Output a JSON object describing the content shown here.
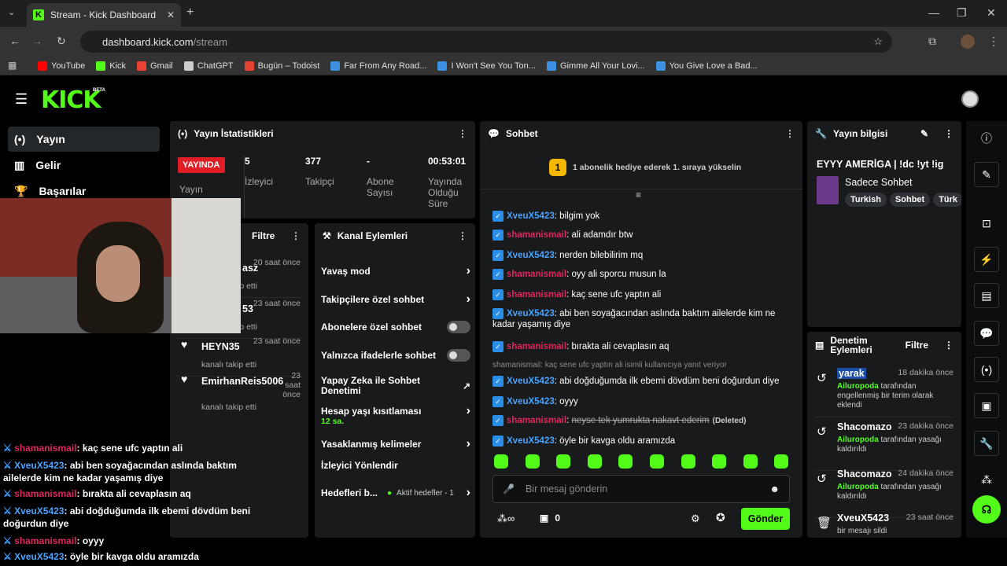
{
  "browser": {
    "tab_title": "Stream - Kick Dashboard",
    "url_host": "dashboard.kick.com",
    "url_path": "/stream",
    "bookmarks": [
      {
        "label": "YouTube",
        "color": "#ff0000"
      },
      {
        "label": "Kick",
        "color": "#53fc18"
      },
      {
        "label": "Gmail",
        "color": "#ea4335"
      },
      {
        "label": "ChatGPT",
        "color": "#cccccc"
      },
      {
        "label": "Bugün – Todoist",
        "color": "#e44332"
      },
      {
        "label": "Far From Any Road...",
        "color": "#3d8fe0"
      },
      {
        "label": "I Won't See You Ton...",
        "color": "#3d8fe0"
      },
      {
        "label": "Gimme All Your Lovi...",
        "color": "#3d8fe0"
      },
      {
        "label": "You Give Love a Bad...",
        "color": "#3d8fe0"
      }
    ]
  },
  "nav": {
    "logo": "KICK",
    "beta": "BETA",
    "items": [
      "Yayın",
      "Gelir",
      "Başarılar"
    ]
  },
  "stats": {
    "title": "Yayın İstatistikleri",
    "live_badge": "YAYINDA",
    "stream_label": "Yayın",
    "viewers": {
      "value": "5",
      "label": "İzleyici"
    },
    "followers": {
      "value": "377",
      "label": "Takipçi"
    },
    "subs": {
      "value": "-",
      "label": "Abone Sayısı"
    },
    "duration": {
      "value": "00:53:01",
      "label": "Yayında Olduğu Süre"
    }
  },
  "activity": {
    "filter": "Filtre",
    "items": [
      {
        "name": "asz",
        "time": "20 saat önce",
        "sub": "ip etti"
      },
      {
        "name": "53",
        "time": "23 saat önce",
        "sub": "ip etti"
      },
      {
        "name": "HEYN35",
        "time": "23 saat önce",
        "sub": "kanalı takip etti"
      },
      {
        "name": "EmirhanReis5006",
        "time": "23 saat önce",
        "sub": "kanalı takip etti"
      }
    ]
  },
  "actions": {
    "title": "Kanal Eylemleri",
    "items": [
      {
        "label": "Yavaş mod",
        "type": "chev"
      },
      {
        "label": "Takipçilere özel sohbet",
        "type": "chev"
      },
      {
        "label": "Abonelere özel sohbet",
        "type": "toggle"
      },
      {
        "label": "Yalnızca ifadelerle sohbet",
        "type": "toggle"
      },
      {
        "label": "Yapay Zeka ile Sohbet Denetimi",
        "type": "ext"
      },
      {
        "label": "Hesap yaşı kısıtlaması",
        "type": "chev",
        "sub": "12 sa."
      },
      {
        "label": "Yasaklanmış kelimeler",
        "type": "chev"
      },
      {
        "label": "İzleyici Yönlendir",
        "type": "none"
      },
      {
        "label": "Hedefleri b...",
        "type": "chev",
        "sub": "Aktif hedefler - 1"
      }
    ]
  },
  "chat": {
    "title": "Sohbet",
    "gift_banner": "1 abonelik hediye ederek 1. sıraya yükselin",
    "reply_note": "shamanismail: kaç sene ufc yaptın ali isimli kullanıcıya yanıt veriyor",
    "messages": [
      {
        "user": "XveuX5423",
        "text": "bilgim yok",
        "c": 1
      },
      {
        "user": "shamanismail",
        "text": "ali adamdır btw",
        "c": 2
      },
      {
        "user": "XveuX5423",
        "text": "nerden bilebilirim mq",
        "c": 1
      },
      {
        "user": "shamanismail",
        "text": "oyy ali sporcu musun la",
        "c": 2
      },
      {
        "user": "shamanismail",
        "text": "kaç sene ufc yaptın ali",
        "c": 2
      },
      {
        "user": "XveuX5423",
        "text": "abi ben soyağacından aslında baktım ailelerde kim ne kadar yaşamış diye",
        "c": 1
      },
      {
        "user": "shamanismail",
        "text": "bırakta ali cevaplasın aq",
        "c": 2
      },
      {
        "user": "XveuX5423",
        "text": "abi doğduğumda ilk ebemi dövdüm beni doğurdun diye",
        "c": 1
      },
      {
        "user": "XveuX5423",
        "text": "oyyy",
        "c": 1
      },
      {
        "user": "shamanismail",
        "text": "neyse tek yumrukta nakavt ederim",
        "c": 2,
        "deleted": "(Deleted)"
      },
      {
        "user": "XveuX5423",
        "text": "öyle bir kavga oldu aramızda",
        "c": 1
      }
    ],
    "input_placeholder": "Bir mesaj gönderin",
    "points": "0",
    "send": "Gönder"
  },
  "info": {
    "title": "Yayın bilgisi",
    "stream_title": "EYYY AMERİGA | !dc !yt !ig",
    "category": "Sadece Sohbet",
    "tags": [
      "Turkish",
      "Sohbet",
      "Türk"
    ]
  },
  "moderation": {
    "title": "Denetim Eylemleri",
    "filter": "Filtre",
    "items": [
      {
        "name": "yarak",
        "time": "18 dakika önce",
        "by": "Ailuropoda",
        "desc": " tarafından engellenmiş bir terim olarak eklendi"
      },
      {
        "name": "Shacomazo",
        "time": "23 dakika önce",
        "by": "Ailuropoda",
        "desc": " tarafından yasağı kaldırıldı"
      },
      {
        "name": "Shacomazo",
        "time": "24 dakika önce",
        "by": "Ailuropoda",
        "desc": " tarafından yasağı kaldırıldı"
      },
      {
        "name": "XveuX5423",
        "time": "23 saat önce",
        "by": "",
        "desc": "bir mesajı sildi"
      }
    ]
  },
  "overlay_chat": [
    {
      "user": "shamanismail",
      "text": "kaç sene ufc yaptın ali",
      "c": 2
    },
    {
      "user": "XveuX5423",
      "text": "abi ben soyağacından aslında baktım ailelerde kim ne kadar yaşamış diye",
      "c": 1
    },
    {
      "user": "shamanismail",
      "text": "bırakta ali cevaplasın aq",
      "c": 2
    },
    {
      "user": "XveuX5423",
      "text": "abi doğduğumda ilk ebemi dövdüm beni doğurdun diye",
      "c": 1
    },
    {
      "user": "shamanismail",
      "text": "oyyy",
      "c": 2
    },
    {
      "user": "XveuX5423",
      "text": "öyle bir kavga oldu aramızda",
      "c": 1
    }
  ]
}
